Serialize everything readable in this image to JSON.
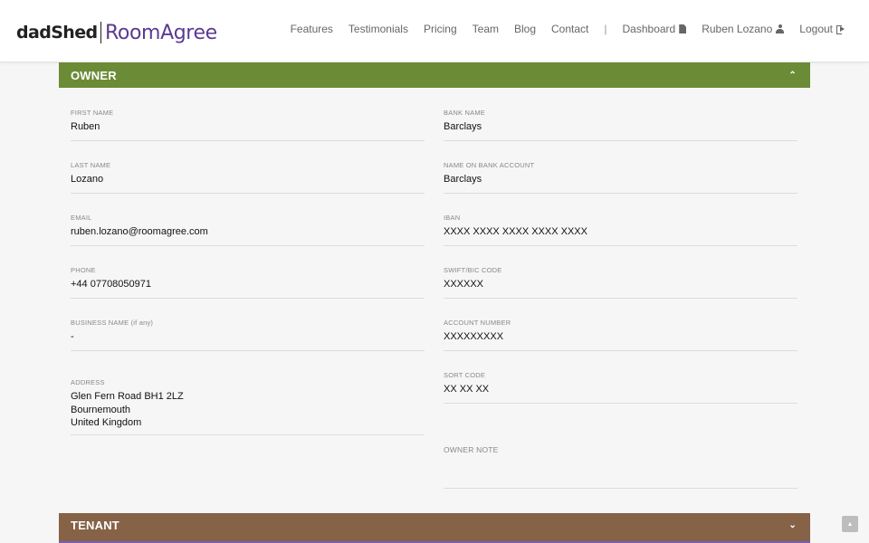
{
  "brand": {
    "dadshed": "dadShed",
    "roomagree": "RoomAgree"
  },
  "nav": {
    "features": "Features",
    "testimonials": "Testimonials",
    "pricing": "Pricing",
    "team": "Team",
    "blog": "Blog",
    "contact": "Contact",
    "separator": "|",
    "dashboard": "Dashboard",
    "user": "Ruben Lozano",
    "logout": "Logout"
  },
  "owner": {
    "title": "OWNER",
    "toggle_icon": "chevron-up-icon",
    "left_fields": [
      {
        "label": "FIRST NAME",
        "value": "Ruben"
      },
      {
        "label": "LAST NAME",
        "value": "Lozano"
      },
      {
        "label": "EMAIL",
        "value": "ruben.lozano@roomagree.com"
      },
      {
        "label": "PHONE",
        "value": "+44 07708050971"
      },
      {
        "label": "BUSINESS NAME (if any)",
        "value": "-"
      },
      {
        "label": "ADDRESS",
        "value": "Glen Fern Road BH1 2LZ\nBournemouth\nUnited Kingdom"
      }
    ],
    "right_fields": [
      {
        "label": "BANK NAME",
        "value": "Barclays"
      },
      {
        "label": "NAME ON BANK ACCOUNT",
        "value": "Barclays"
      },
      {
        "label": "IBAN",
        "value": "XXXX XXXX XXXX XXXX XXXX"
      },
      {
        "label": "SWIFT/BIC CODE",
        "value": "XXXXXX"
      },
      {
        "label": "ACCOUNT NUMBER",
        "value": "XXXXXXXXX"
      },
      {
        "label": "SORT CODE",
        "value": "XX XX XX"
      }
    ],
    "note_label": "OWNER NOTE"
  },
  "tenant": {
    "title": "TENANT",
    "toggle_icon": "chevron-down-icon"
  },
  "colors": {
    "owner_header": "#6b8b36",
    "tenant_header": "#866247",
    "brand_purple": "#5a3a92"
  }
}
